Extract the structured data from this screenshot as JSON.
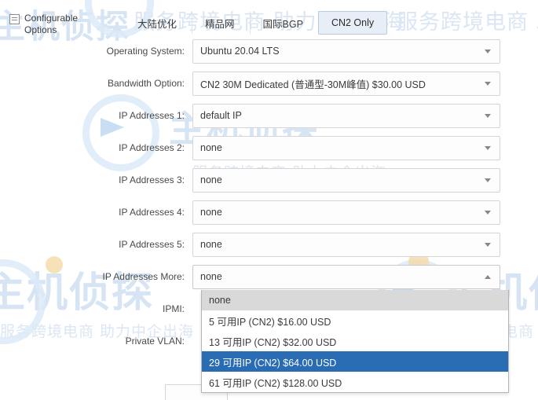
{
  "section": {
    "icon": "list-icon",
    "title": "Configurable Options"
  },
  "tabs": [
    {
      "label": "大陆优化",
      "active": false
    },
    {
      "label": "精品网",
      "active": false
    },
    {
      "label": "国际BGP",
      "active": false
    },
    {
      "label": "CN2 Only",
      "active": true
    }
  ],
  "fields": [
    {
      "label": "Operating System:",
      "value": "Ubuntu 20.04 LTS",
      "caret": "down"
    },
    {
      "label": "Bandwidth Option:",
      "value": "CN2 30M Dedicated (普通型-30M峰值) $30.00 USD",
      "caret": "down"
    },
    {
      "label": "IP Addresses 1:",
      "value": "default IP",
      "caret": "down"
    },
    {
      "label": "IP Addresses 2:",
      "value": "none",
      "caret": "down"
    },
    {
      "label": "IP Addresses 3:",
      "value": "none",
      "caret": "down"
    },
    {
      "label": "IP Addresses 4:",
      "value": "none",
      "caret": "down"
    },
    {
      "label": "IP Addresses 5:",
      "value": "none",
      "caret": "down"
    },
    {
      "label": "IP Addresses More:",
      "value": "none",
      "caret": "up"
    },
    {
      "label": "IPMI:",
      "value": "",
      "caret": "down"
    },
    {
      "label": "Private VLAN:",
      "value": "",
      "caret": "down"
    }
  ],
  "dropdown": {
    "open_for": "IP Addresses More:",
    "options": [
      {
        "label": "none",
        "state": "hover"
      },
      {
        "label": "5 可用IP (CN2) $16.00 USD",
        "state": "normal"
      },
      {
        "label": "13 可用IP (CN2) $32.00 USD",
        "state": "normal"
      },
      {
        "label": "29 可用IP (CN2) $64.00 USD",
        "state": "selected"
      },
      {
        "label": "61 可用IP (CN2) $128.00 USD",
        "state": "normal"
      }
    ]
  },
  "watermarks": {
    "logo": "主机侦探",
    "tagline": "服务跨境电商 助力中企出海"
  },
  "colors": {
    "selected_blue": "#2a6cb4",
    "hover_gray": "#d9d9d9",
    "active_tab_bg": "#e8eef7",
    "active_tab_border": "#b9cbe2",
    "field_border": "#d5d5d5",
    "watermark_blue": "#cfe0f2"
  }
}
